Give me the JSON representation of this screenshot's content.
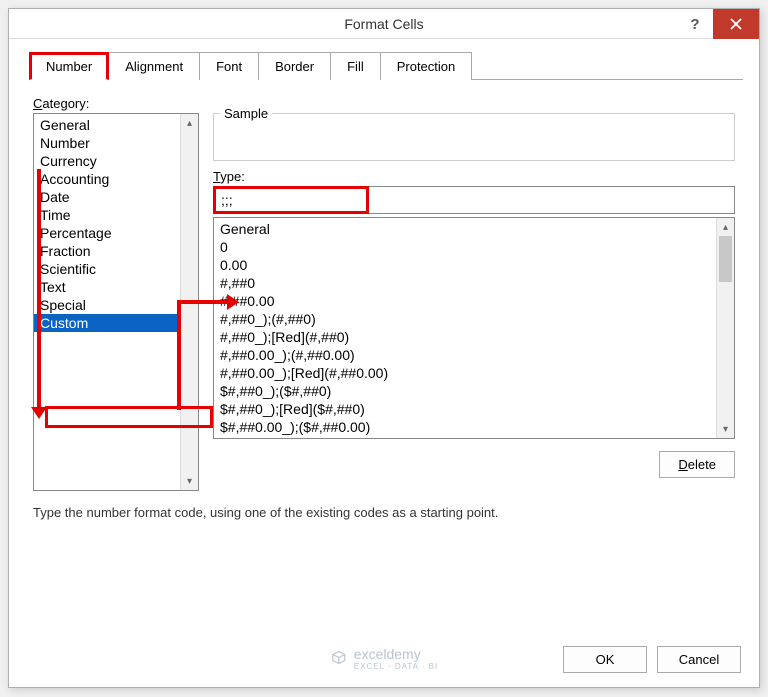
{
  "dialog": {
    "title": "Format Cells",
    "help_aria": "Help",
    "close_aria": "Close"
  },
  "tabs": [
    {
      "label": "Number",
      "key": "number",
      "active": true
    },
    {
      "label": "Alignment",
      "key": "alignment"
    },
    {
      "label": "Font",
      "key": "font"
    },
    {
      "label": "Border",
      "key": "border"
    },
    {
      "label": "Fill",
      "key": "fill"
    },
    {
      "label": "Protection",
      "key": "protection"
    }
  ],
  "category_label": "Category:",
  "categories": [
    "General",
    "Number",
    "Currency",
    "Accounting",
    "Date",
    "Time",
    "Percentage",
    "Fraction",
    "Scientific",
    "Text",
    "Special",
    "Custom"
  ],
  "selected_category_index": 11,
  "sample_label": "Sample",
  "sample_value": "",
  "type_label": "Type:",
  "type_value": ";;;",
  "format_codes": [
    "General",
    "0",
    "0.00",
    "#,##0",
    "#,##0.00",
    "#,##0_);(#,##0)",
    "#,##0_);[Red](#,##0)",
    "#,##0.00_);(#,##0.00)",
    "#,##0.00_);[Red](#,##0.00)",
    "$#,##0_);($#,##0)",
    "$#,##0_);[Red]($#,##0)",
    "$#,##0.00_);($#,##0.00)"
  ],
  "delete_label": "Delete",
  "hint": "Type the number format code, using one of the existing codes as a starting point.",
  "ok_label": "OK",
  "cancel_label": "Cancel",
  "watermark": {
    "brand": "exceldemy",
    "tagline": "EXCEL · DATA · BI"
  },
  "colors": {
    "accent_red": "#e60000",
    "select_blue": "#0a64c4",
    "close_red": "#c0392b"
  }
}
